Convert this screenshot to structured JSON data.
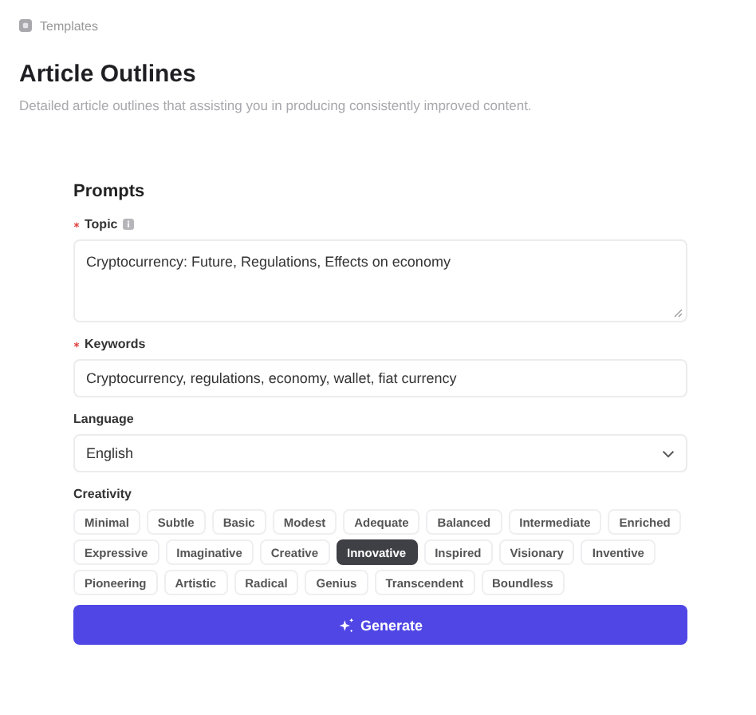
{
  "breadcrumb": {
    "label": "Templates"
  },
  "title": "Article Outlines",
  "subtitle": "Detailed article outlines that assisting you in producing consistently improved content.",
  "form": {
    "heading": "Prompts",
    "fields": [
      {
        "kind": "textarea",
        "label": "Topic",
        "required": true,
        "info": true,
        "value": "Cryptocurrency: Future, Regulations, Effects on economy"
      },
      {
        "kind": "input",
        "label": "Keywords",
        "required": true,
        "info": false,
        "value": "Cryptocurrency, regulations, economy, wallet, fiat currency"
      },
      {
        "kind": "select",
        "label": "Language",
        "required": false,
        "info": false,
        "value": "English"
      }
    ],
    "creativity": {
      "label": "Creativity",
      "options": [
        {
          "label": "Minimal",
          "selected": false
        },
        {
          "label": "Subtle",
          "selected": false
        },
        {
          "label": "Basic",
          "selected": false
        },
        {
          "label": "Modest",
          "selected": false
        },
        {
          "label": "Adequate",
          "selected": false
        },
        {
          "label": "Balanced",
          "selected": false
        },
        {
          "label": "Intermediate",
          "selected": false
        },
        {
          "label": "Enriched",
          "selected": false
        },
        {
          "label": "Expressive",
          "selected": false
        },
        {
          "label": "Imaginative",
          "selected": false
        },
        {
          "label": "Creative",
          "selected": false
        },
        {
          "label": "Innovative",
          "selected": true
        },
        {
          "label": "Inspired",
          "selected": false
        },
        {
          "label": "Visionary",
          "selected": false
        },
        {
          "label": "Inventive",
          "selected": false
        },
        {
          "label": "Pioneering",
          "selected": false
        },
        {
          "label": "Artistic",
          "selected": false
        },
        {
          "label": "Radical",
          "selected": false
        },
        {
          "label": "Genius",
          "selected": false
        },
        {
          "label": "Transcendent",
          "selected": false
        },
        {
          "label": "Boundless",
          "selected": false
        }
      ]
    },
    "submit": "Generate"
  }
}
